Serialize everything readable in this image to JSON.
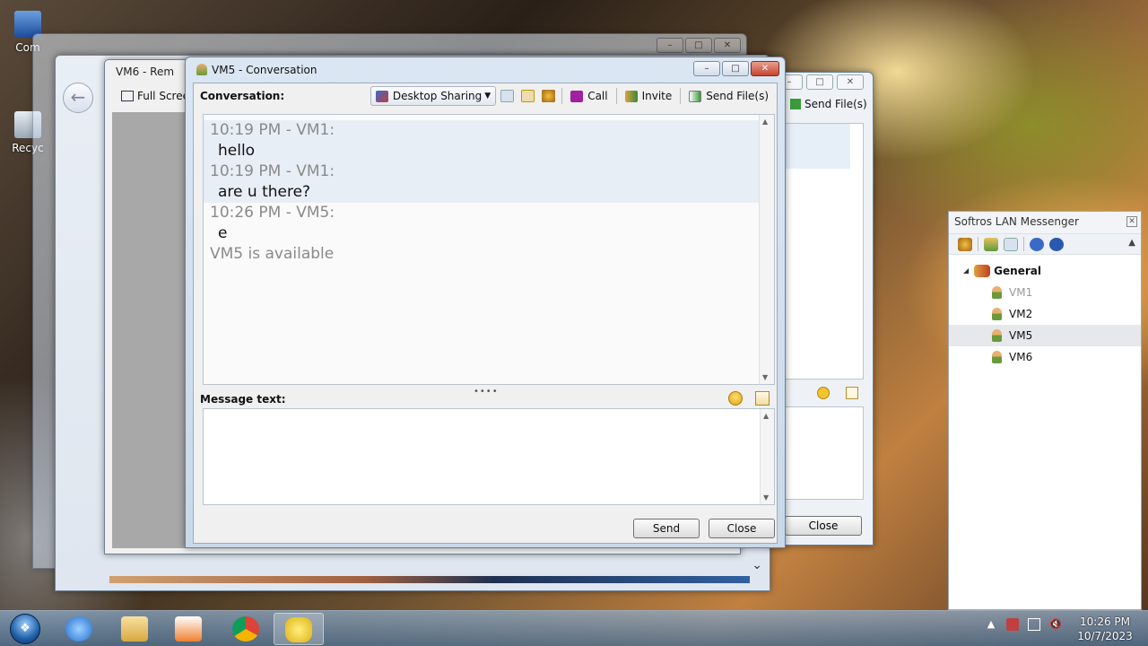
{
  "desktop": {
    "icons": [
      {
        "label": "Com"
      },
      {
        "label": "Recyc"
      }
    ]
  },
  "remote_window": {
    "title": "VM6 - Rem",
    "full_screen_label": "Full Scree"
  },
  "back_conversation": {
    "send_files_label": "Send File(s)",
    "close_label": "Close"
  },
  "conversation_window": {
    "title": "VM5 - Conversation",
    "conversation_label": "Conversation:",
    "toolbar": {
      "desktop_sharing": "Desktop Sharing",
      "call": "Call",
      "invite": "Invite",
      "send_files": "Send File(s)"
    },
    "messages": [
      {
        "header": "10:19 PM - VM1:",
        "text": "hello",
        "highlighted": true
      },
      {
        "header": "10:19 PM - VM1:",
        "text": "are u there?",
        "highlighted": true
      },
      {
        "header": "10:26 PM - VM5:",
        "text": "e",
        "highlighted": false
      }
    ],
    "status_line": "VM5 is available",
    "message_text_label": "Message text:",
    "message_input_value": "",
    "send_label": "Send",
    "close_label": "Close"
  },
  "messenger": {
    "title": "Softros LAN Messenger",
    "group": "General",
    "users": [
      {
        "name": "VM1",
        "online": false,
        "selected": false
      },
      {
        "name": "VM2",
        "online": true,
        "selected": false
      },
      {
        "name": "VM5",
        "online": true,
        "selected": true
      },
      {
        "name": "VM6",
        "online": true,
        "selected": false
      }
    ]
  },
  "taskbar": {
    "clock_time": "10:26 PM",
    "clock_date": "10/7/2023"
  },
  "colors": {
    "selection": "#e6e8eb",
    "history_highlight": "#e8eef6",
    "title_bar": "#dbe6f3",
    "close_red": "#c4452f"
  }
}
